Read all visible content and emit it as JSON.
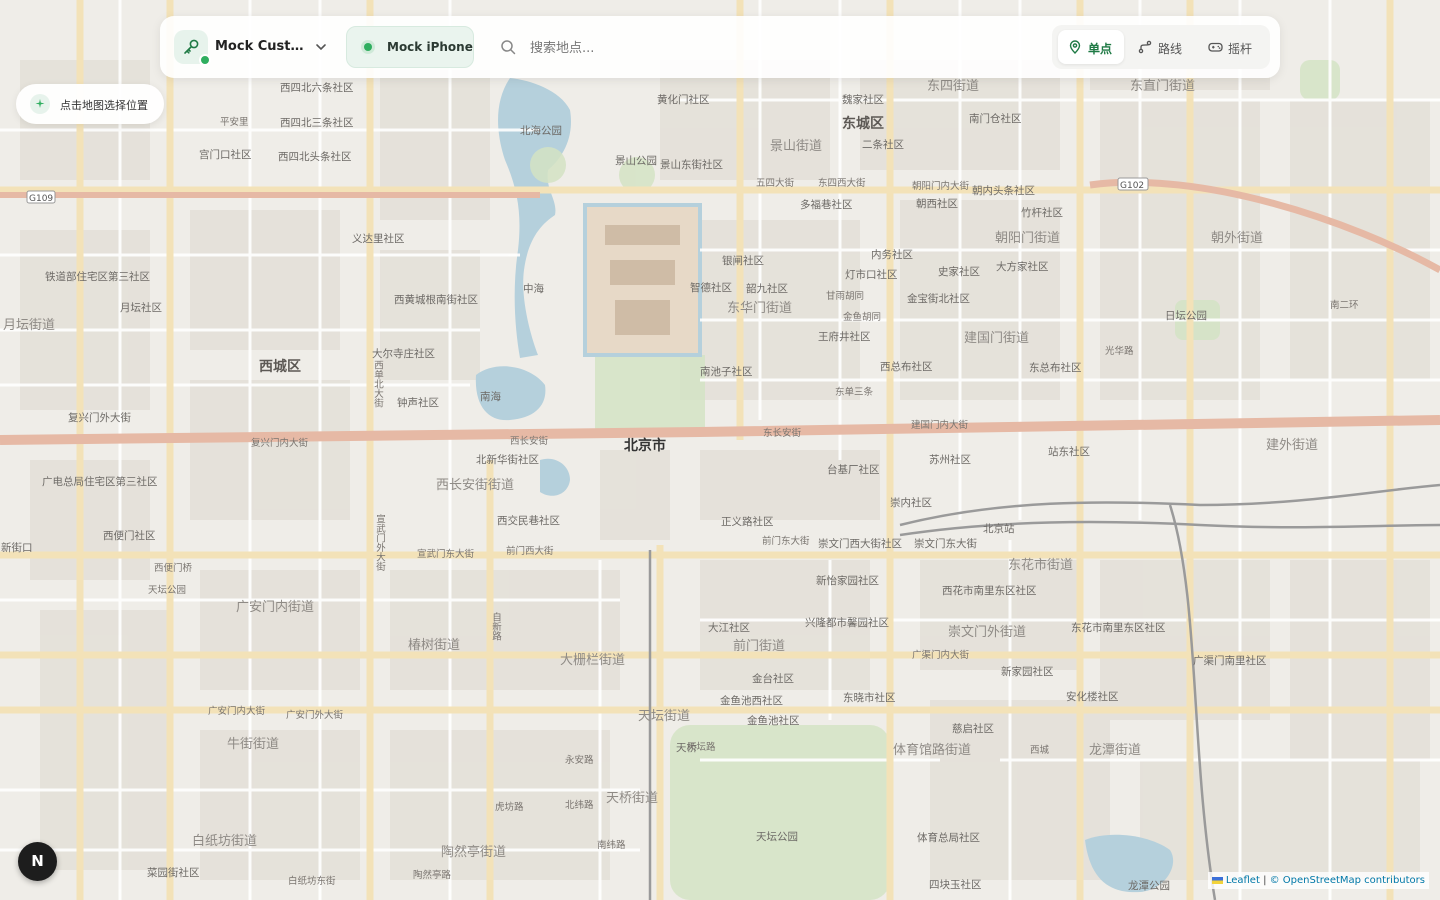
{
  "topbar": {
    "device_selector": {
      "name": "Mock Custo...",
      "icon": "key-icon",
      "status_color": "#2fae5f"
    },
    "phone_chip": {
      "label": "Mock iPhone",
      "status_color": "#2fae5f"
    },
    "search": {
      "placeholder": "搜索地点...",
      "value": ""
    },
    "modes": [
      {
        "id": "single",
        "label": "单点",
        "icon": "map-pin-icon",
        "active": true
      },
      {
        "id": "route",
        "label": "路线",
        "icon": "route-icon",
        "active": false
      },
      {
        "id": "joystick",
        "label": "摇杆",
        "icon": "gamepad-icon",
        "active": false
      }
    ]
  },
  "hint": {
    "label": "点击地图选择位置",
    "icon": "sparkle-icon"
  },
  "compass": {
    "label": "N"
  },
  "attribution": {
    "leaflet": "Leaflet",
    "separator": "|",
    "copyright": "© OpenStreetMap contributors"
  },
  "map": {
    "city": "北京市",
    "districts": [
      "东城区",
      "西城区"
    ],
    "parks": [
      "北海公园",
      "景山公园",
      "天坛公园",
      "中海",
      "南海"
    ],
    "labels": [
      "黄化门社区",
      "魏家社区",
      "东四街道",
      "东直门街道",
      "南门仓社区",
      "二条社区",
      "景山街道",
      "景山东街社区",
      "五四大街",
      "东四西大街",
      "朝阳门内大街",
      "朝内头条社区",
      "多福巷社区",
      "朝阳门街道",
      "竹杆社区",
      "朝外街道",
      "朝西社区",
      "银闸社区",
      "内务社区",
      "大方家社区",
      "东华门街道",
      "灯市口社区",
      "史家社区",
      "智德社区",
      "韶九社区",
      "甘雨胡同",
      "金宝街北社区",
      "王府井社区",
      "金鱼胡同",
      "建国门街道",
      "日坛公园",
      "南池子社区",
      "西总布社区",
      "东总布社区",
      "光华路",
      "东长安街",
      "建国门内大街",
      "东单三条",
      "苏州社区",
      "站东社区",
      "台基厂社区",
      "建外街道",
      "崇内社区",
      "北京站",
      "正义路社区",
      "前门东大街",
      "崇文门东大街",
      "崇文门西大街社区",
      "东花市街道",
      "新怡家园社区",
      "西花市南里东区社区",
      "兴隆都市馨园社区",
      "大江社区",
      "前门街道",
      "崇文门外街道",
      "东花市南里东区社区",
      "金台社区",
      "金鱼池西社区",
      "东晓市社区",
      "新家园社区",
      "安化楼社区",
      "广渠门内大街",
      "广渠门南里社区",
      "天坛街道",
      "金鱼池社区",
      "体育馆路街道",
      "龙潭街道",
      "慈启社区",
      "体育总局社区",
      "四块玉社区",
      "龙潭公园",
      "天桥街道",
      "陶然亭街道",
      "西长安街",
      "西长安街街道",
      "西交民巷社区",
      "前门西大街",
      "宣武门东大街",
      "大栅栏街道",
      "椿树街道",
      "牛街街道",
      "广安门内街道",
      "白纸坊街道",
      "广安门内大街",
      "复兴门内大街",
      "西单北大街",
      "西四北六条社区",
      "西四北三条社区",
      "西四北头条社区",
      "宫门口社区",
      "义达里社区",
      "西黄城根南街社区",
      "大尔寺庄社区",
      "钟声社区",
      "北新华街社区",
      "月坛街道",
      "铁道部住宅区第三社区",
      "月坛社区",
      "复兴门外大街",
      "西便门社区",
      "西便门桥",
      "广电总局住宅区第三社区",
      "新街口",
      "平安里",
      "天桥",
      "白纸坊东街",
      "南二环",
      "宣武门外大街",
      "广安门外大街",
      "菜园街社区",
      "陶然亭路",
      "永安路",
      "天坛路",
      "北纬路",
      "南纬路",
      "自新路",
      "虎坊路",
      "西城",
      "天坛公园"
    ]
  }
}
